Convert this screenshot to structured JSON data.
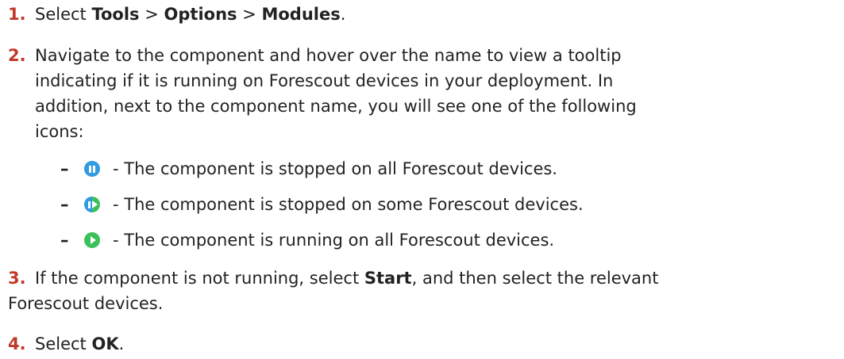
{
  "steps": [
    {
      "num": "1.",
      "parts": [
        {
          "t": "Select "
        },
        {
          "t": "Tools",
          "b": true
        },
        {
          "t": " > "
        },
        {
          "t": "Options",
          "b": true
        },
        {
          "t": " > "
        },
        {
          "t": "Modules",
          "b": true
        },
        {
          "t": "."
        }
      ]
    },
    {
      "num": "2.",
      "lines": [
        "Navigate to the component and hover over the name to view a tooltip",
        "indicating if it is running on Forescout devices in your deployment. In",
        "addition, next to the component name, you will see one of the following",
        "icons:"
      ]
    },
    {
      "num": "3.",
      "parts": [
        {
          "t": "If the component is not running, select "
        },
        {
          "t": "Start",
          "b": true
        },
        {
          "t": ", and then select the relevant"
        }
      ],
      "continuation": "Forescout devices."
    },
    {
      "num": "4.",
      "parts": [
        {
          "t": "Select "
        },
        {
          "t": "OK",
          "b": true
        },
        {
          "t": "."
        }
      ]
    }
  ],
  "icon_items": [
    {
      "dash": "–",
      "icon": "pause-icon",
      "text": "- The component is stopped on all Forescout devices.",
      "color": "#2f9be0"
    },
    {
      "dash": "–",
      "icon": "partial-icon",
      "text": "- The component is stopped on some Forescout devices.",
      "color_left": "#2f9be0",
      "color_right": "#3cc05a"
    },
    {
      "dash": "–",
      "icon": "play-icon",
      "text": "- The component is running on all Forescout devices.",
      "color": "#3cc05a"
    }
  ]
}
